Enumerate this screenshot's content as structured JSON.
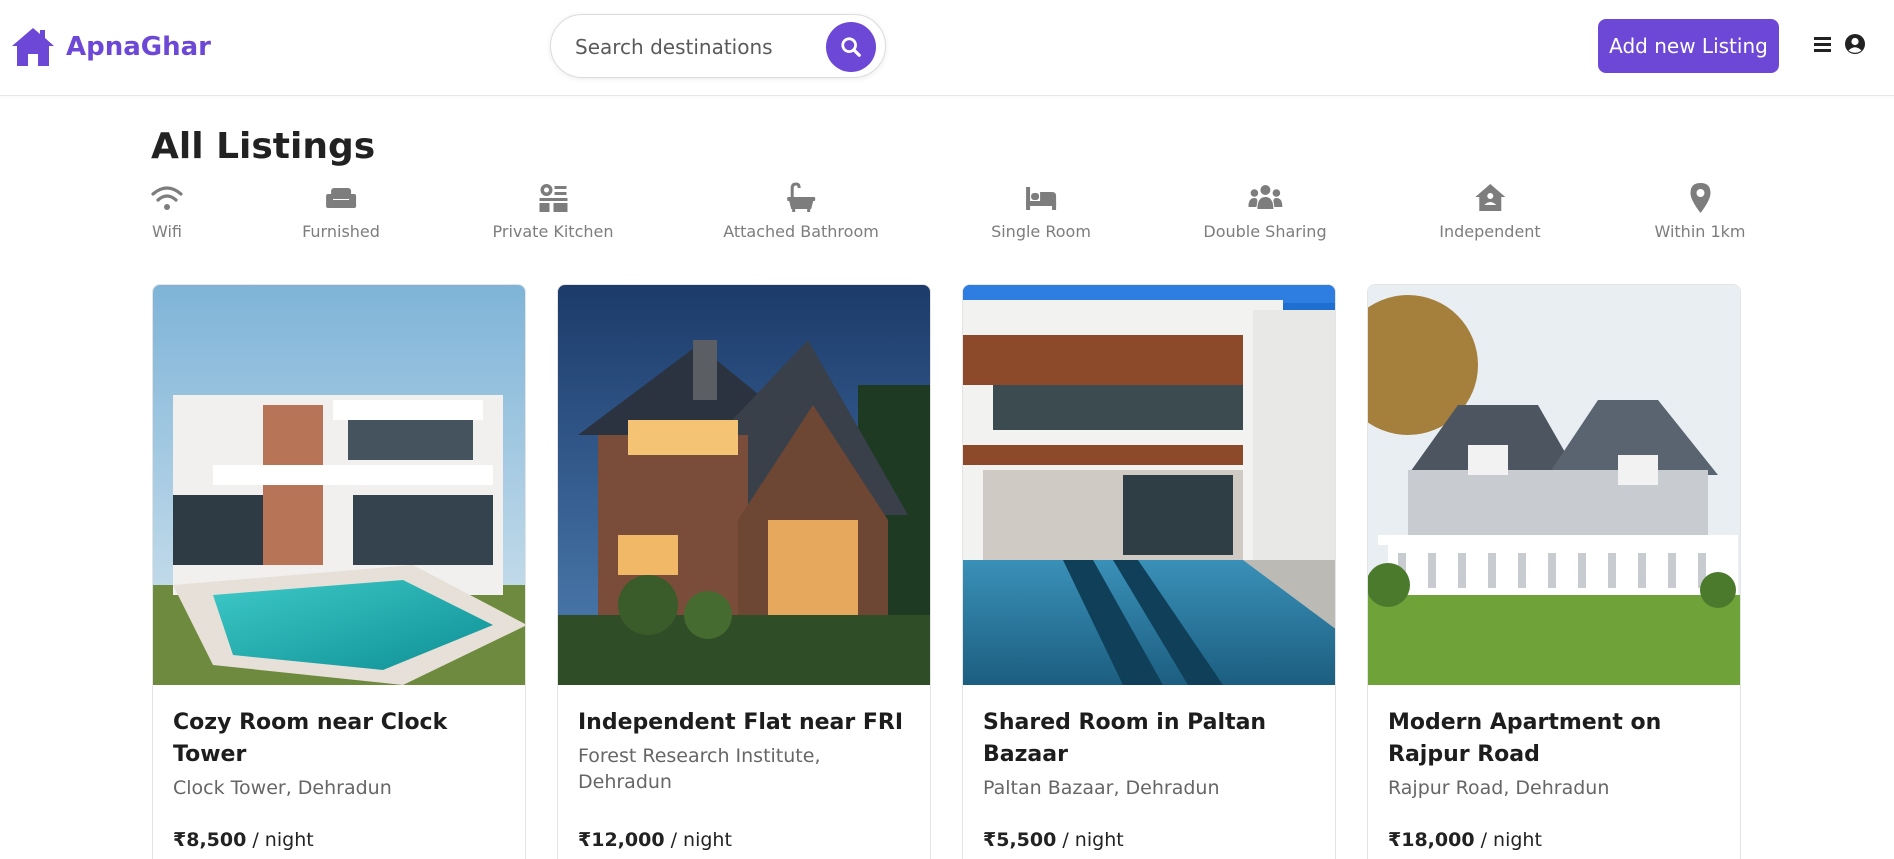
{
  "brand": {
    "name": "ApnaGhar",
    "color": "#6d48d6"
  },
  "search": {
    "placeholder": "Search destinations"
  },
  "nav": {
    "add_listing": "Add new Listing"
  },
  "page": {
    "title": "All Listings"
  },
  "filters": [
    {
      "label": "Wifi",
      "icon": "wifi-icon"
    },
    {
      "label": "Furnished",
      "icon": "sofa-icon"
    },
    {
      "label": "Private Kitchen",
      "icon": "kitchen-icon"
    },
    {
      "label": "Attached Bathroom",
      "icon": "bathtub-icon"
    },
    {
      "label": "Single Room",
      "icon": "bed-icon"
    },
    {
      "label": "Double Sharing",
      "icon": "people-icon"
    },
    {
      "label": "Independent",
      "icon": "house-icon"
    },
    {
      "label": "Within 1km",
      "icon": "location-pin-icon"
    }
  ],
  "listings": [
    {
      "title": "Cozy Room near Clock Tower",
      "location": "Clock Tower, Dehradun",
      "price": "₹8,500",
      "unit": " / night"
    },
    {
      "title": "Independent Flat near FRI",
      "location": "Forest Research Institute, Dehradun",
      "price": "₹12,000",
      "unit": " / night"
    },
    {
      "title": "Shared Room in Paltan Bazaar",
      "location": "Paltan Bazaar, Dehradun",
      "price": "₹5,500",
      "unit": " / night"
    },
    {
      "title": "Modern Apartment on Rajpur Road",
      "location": "Rajpur Road, Dehradun",
      "price": "₹18,000",
      "unit": " / night"
    }
  ]
}
